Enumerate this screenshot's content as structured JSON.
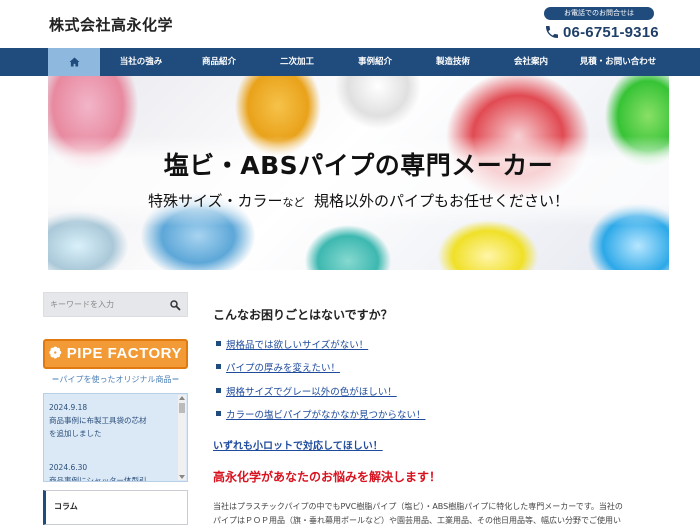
{
  "header": {
    "company_name": "株式会社高永化学",
    "phone_badge": "お電話でのお問合せは",
    "phone_number": "06-6751-9316"
  },
  "nav": {
    "home_icon": "home-icon",
    "items": [
      "当社の強み",
      "商品紹介",
      "二次加工",
      "事例紹介",
      "製造技術",
      "会社案内",
      "見積・お問い合わせ"
    ]
  },
  "hero": {
    "title": "塩ビ・ABSパイプの専門メーカー",
    "subtitle_part1": "特殊サイズ・カラー",
    "subtitle_small": "など",
    "subtitle_part2": "規格以外のパイプもお任せください！"
  },
  "sidebar": {
    "search_placeholder": "キーワードを入力",
    "pipe_factory_label": "PIPE FACTORY",
    "pipe_factory_sub": "＝パイプを使ったオリジナル商品＝",
    "news": [
      {
        "date": "2024.9.18",
        "line1": "商品事例に布製工具袋の芯材",
        "line2": "を追加しました"
      },
      {
        "date": "2024.6.30",
        "line1": "商品事例にシャッター体型引"
      }
    ],
    "column_label": "コラム"
  },
  "main": {
    "question": "こんなお困りごとはないですか？",
    "checks": [
      "規格品では欲しいサイズがない！",
      "パイプの厚みを変えたい！",
      "規格サイズでグレー以外の色がほしい！",
      "カラーの塩ビパイプがなかなか見つからない！"
    ],
    "small_lot": "いずれも小ロットで対応してほしい！",
    "solve_heading": "高永化学があなたのお悩みを解決します！",
    "body_line1": "当社はプラスチックパイプの中でもPVC樹脂パイプ（塩ビ）・ABS樹脂パイプに特化した専門メーカーです。当社の",
    "body_line2": "パイプはＰＯＰ用品（旗・垂れ幕用ポールなど）や園芸用品、工業用品、その他日用品等、幅広い分野でご使用い"
  },
  "colors": {
    "nav_bg": "#1f4b7d",
    "nav_home_bg": "#8eb8de",
    "accent_orange": "#f29a35",
    "alert_red": "#d8121f",
    "link_blue": "#1f4b9c"
  }
}
